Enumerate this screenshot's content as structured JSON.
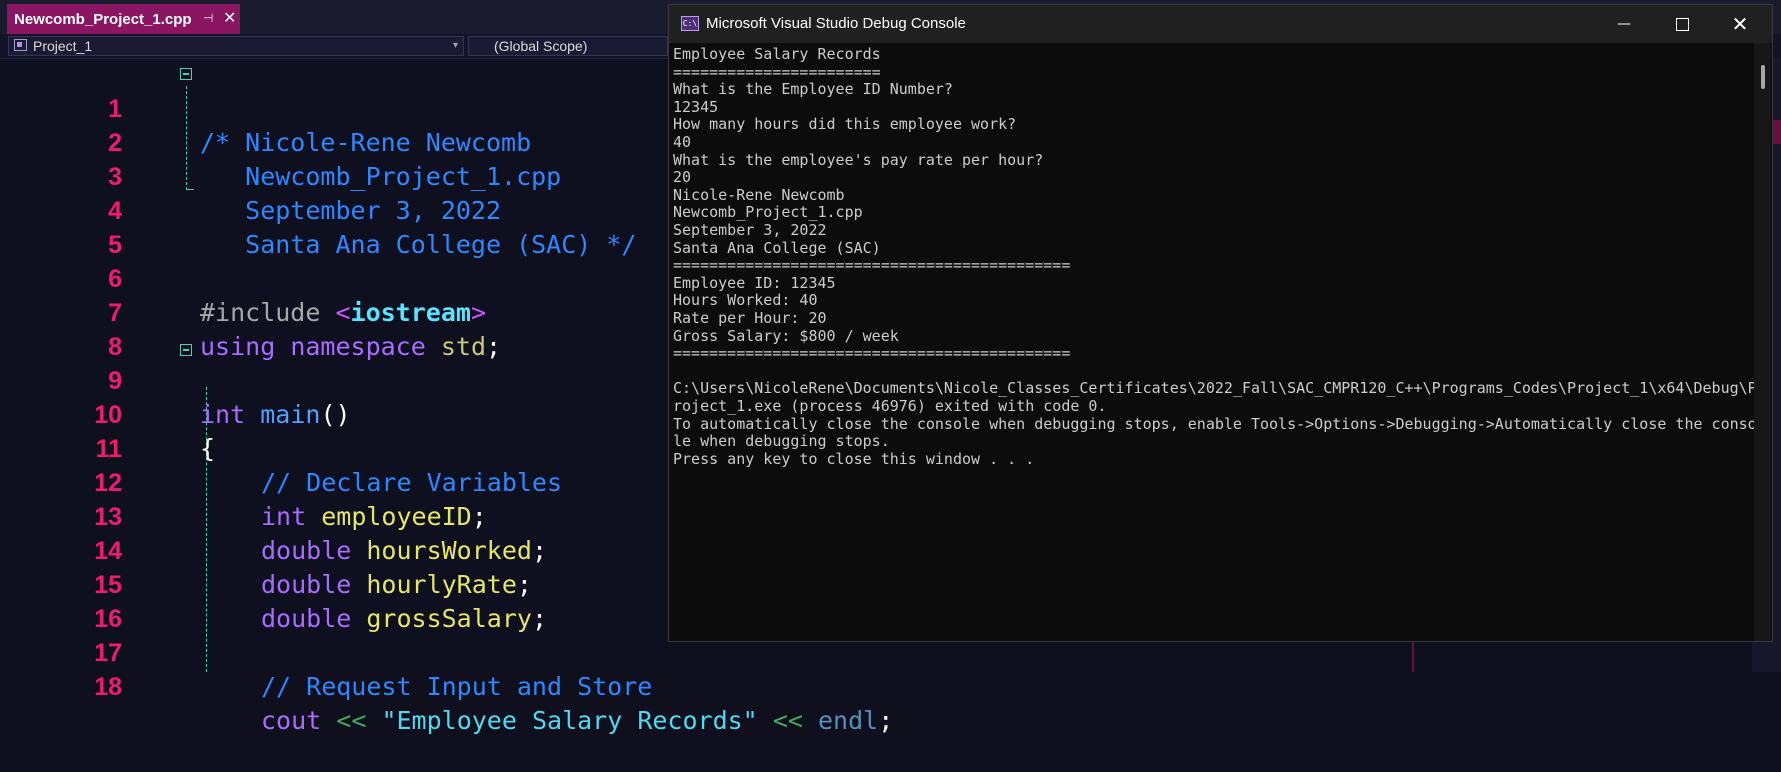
{
  "editor": {
    "tab_title": "Newcomb_Project_1.cpp",
    "tab_pin": "⊣",
    "tab_close": "✕",
    "project_dropdown": "Project_1",
    "scope_dropdown": "(Global Scope)",
    "dropdown_arrow": "▾",
    "line_numbers": [
      "1",
      "2",
      "3",
      "4",
      "5",
      "6",
      "7",
      "8",
      "9",
      "10",
      "11",
      "12",
      "13",
      "14",
      "15",
      "16",
      "17",
      "18"
    ],
    "code": {
      "l1": "/* Nicole-Rene Newcomb",
      "l2": "   Newcomb_Project_1.cpp",
      "l3": "   September 3, 2022",
      "l4": "   Santa Ana College (SAC) */",
      "l6_pp": "#include ",
      "l6_lt": "<",
      "l6_file": "iostream",
      "l6_gt": ">",
      "l7_using": "using",
      "l7_namespace": "namespace",
      "l7_std": "std",
      "l7_semi": ";",
      "l9_int": "int",
      "l9_main": "main",
      "l9_paren": "()",
      "l10_brace": "{",
      "l11_comment": "// Declare Variables",
      "l12_type": "int",
      "l12_var": "employeeID",
      "l13_type": "double",
      "l13_var": "hoursWorked",
      "l14_type": "double",
      "l14_var": "hourlyRate",
      "l15_type": "double",
      "l15_var": "grossSalary",
      "semi": ";",
      "l17_comment": "// Request Input and Store",
      "l18_cout": "cout",
      "l18_op": "<<",
      "l18_str": "\"Employee Salary Records\"",
      "l18_endl": "endl"
    }
  },
  "console": {
    "title": "Microsoft Visual Studio Debug Console",
    "icon_label": "C:\\",
    "minimize": "—",
    "close": "✕",
    "lines": [
      "Employee Salary Records",
      "=======================",
      "What is the Employee ID Number?",
      "12345",
      "How many hours did this employee work?",
      "40",
      "What is the employee's pay rate per hour?",
      "20",
      "Nicole-Rene Newcomb",
      "Newcomb_Project_1.cpp",
      "September 3, 2022",
      "Santa Ana College (SAC)",
      "============================================",
      "Employee ID: 12345",
      "Hours Worked: 40",
      "Rate per Hour: 20",
      "Gross Salary: $800 / week",
      "============================================",
      "",
      "C:\\Users\\NicoleRene\\Documents\\Nicole_Classes_Certificates\\2022_Fall\\SAC_CMPR120_C++\\Programs_Codes\\Project_1\\x64\\Debug\\P",
      "roject_1.exe (process 46976) exited with code 0.",
      "To automatically close the console when debugging stops, enable Tools->Options->Debugging->Automatically close the conso",
      "le when debugging stops.",
      "Press any key to close this window . . ."
    ]
  }
}
